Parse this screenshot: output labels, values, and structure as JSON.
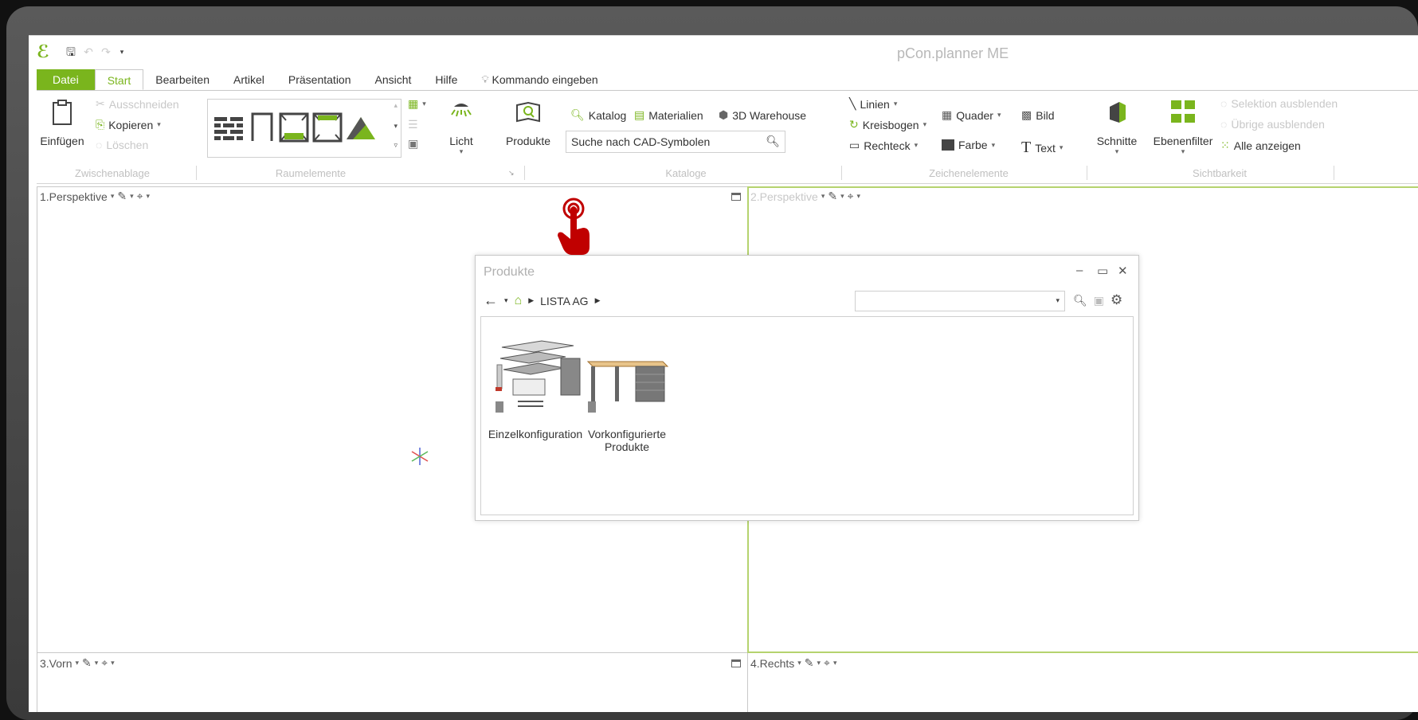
{
  "app": {
    "title": "pCon.planner ME"
  },
  "tabs": [
    "Datei",
    "Start",
    "Bearbeiten",
    "Artikel",
    "Präsentation",
    "Ansicht",
    "Hilfe"
  ],
  "command_tab": "Kommando eingeben",
  "ribbon": {
    "clipboard": {
      "paste": "Einfügen",
      "cut": "Ausschneiden",
      "copy": "Kopieren",
      "delete": "Löschen",
      "group": "Zwischenablage"
    },
    "room_elements": {
      "group": "Raumelemente"
    },
    "light": "Licht",
    "products": "Produkte",
    "catalogs": {
      "catalog": "Katalog",
      "materials": "Materialien",
      "warehouse": "3D Warehouse",
      "search_placeholder": "Suche nach CAD-Symbolen",
      "group": "Kataloge"
    },
    "drawing": {
      "lines": "Linien",
      "arc": "Kreisbogen",
      "rectangle": "Rechteck",
      "box": "Quader",
      "image": "Bild",
      "color": "Farbe",
      "text": "Text",
      "group": "Zeichenelemente"
    },
    "visibility": {
      "sections": "Schnitte",
      "layer_filter": "Ebenenfilter",
      "hide_selection": "Selektion ausblenden",
      "hide_others": "Übrige ausblenden",
      "show_all": "Alle anzeigen",
      "group": "Sichtbarkeit"
    }
  },
  "viewports": {
    "v1": "1.Perspektive",
    "v2": "2.Perspektive",
    "v3": "3.Vorn",
    "v4": "4.Rechts"
  },
  "dialog": {
    "title": "Produkte",
    "breadcrumb": "LISTA AG",
    "items": [
      {
        "label": "Einzelkonfiguration"
      },
      {
        "label": "Vorkonfigurierte Produkte"
      }
    ]
  },
  "colors": {
    "accent": "#7ab51d",
    "cursor": "#c00000"
  }
}
